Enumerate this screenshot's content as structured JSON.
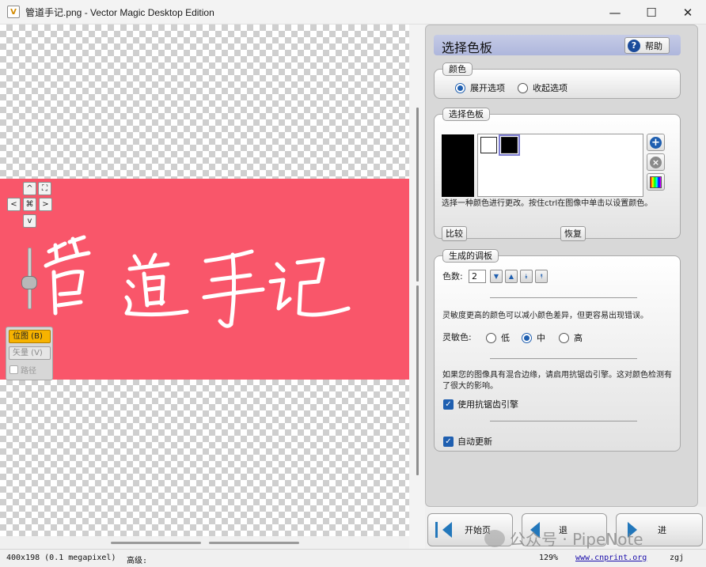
{
  "window": {
    "title": "管道手记.png - Vector Magic Desktop Edition",
    "minimize": "—",
    "maximize": "☐",
    "close": "✕"
  },
  "canvas": {
    "image_text": "管道手记",
    "image_background": "#f9566a",
    "nav": {
      "up": "^",
      "fit": "⛶",
      "left": "<",
      "center": "⌘",
      "right": ">",
      "down": "v"
    },
    "modes": {
      "bitmap": "位图 (B)",
      "vector": "矢量 (V)",
      "paths": "路径"
    }
  },
  "panel": {
    "title": "选择色板",
    "help": "帮助",
    "color_group": {
      "label": "颜色",
      "expand": "展开选项",
      "collapse": "收起选项"
    },
    "palette_group": {
      "label": "选择色板",
      "hint": "选择一种颜色进行更改。按住ctrl在图像中单击以设置颜色。",
      "compare": "比较",
      "restore": "恢复",
      "swatches": [
        "#ffffff",
        "#000000"
      ]
    },
    "generated_group": {
      "label": "生成的调板",
      "count_label": "色数:",
      "count_value": "2",
      "sensitivity_note": "灵敏度更高的颜色可以减小颜色差异，但更容易出现错误。",
      "sensitivity_label": "灵敏色:",
      "low": "低",
      "mid": "中",
      "high": "高",
      "antialias_note": "如果您的图像具有混合边缘，请启用抗锯齿引擎。这对颜色检测有了很大的影响。",
      "antialias_check": "使用抗锯齿引擎",
      "auto_update": "自动更新"
    }
  },
  "bottom_nav": {
    "home": "开始页",
    "back": "退",
    "next": "进"
  },
  "watermark": "公众号 · PipeNote",
  "status": {
    "dims": "400x198 (0.1 megapixel)",
    "level": "高级:",
    "zoom": "129%",
    "url": "www.cnprint.org",
    "user": "zgj"
  }
}
